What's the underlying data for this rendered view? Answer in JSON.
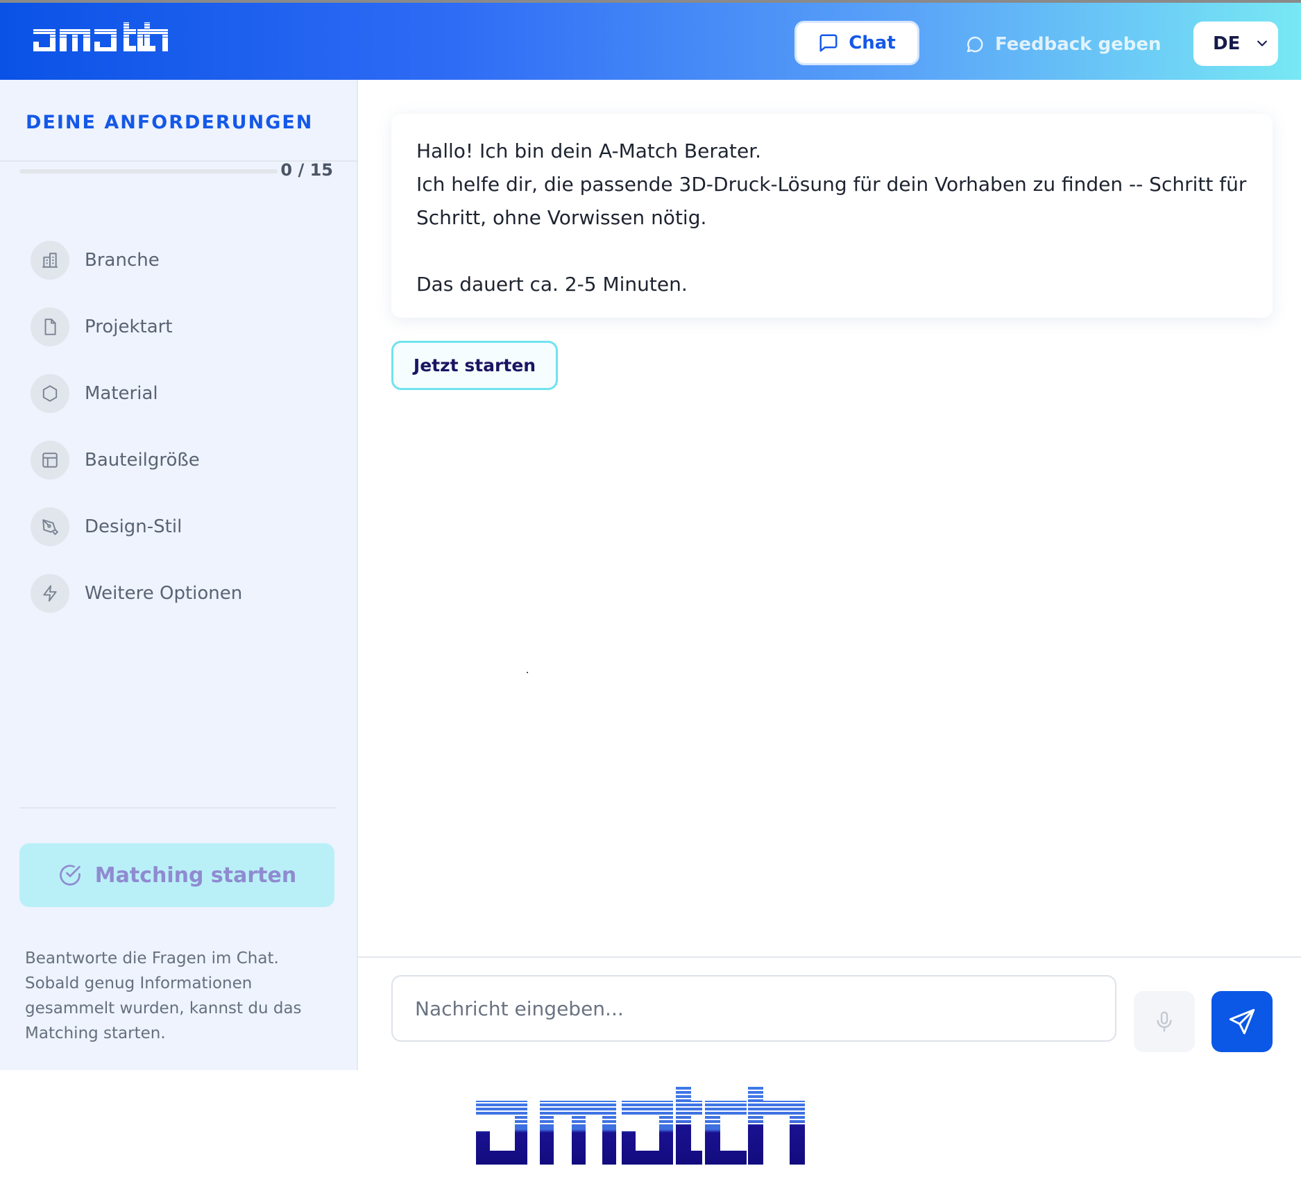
{
  "header": {
    "logo_text": "amatch",
    "nav": {
      "chat_label": "Chat",
      "feedback_label": "Feedback geben"
    },
    "language": {
      "selected": "DE"
    },
    "colors": {
      "primary": "#1558e8",
      "gradient_start": "#0a52e6",
      "gradient_end": "#78e8f4"
    }
  },
  "sidebar": {
    "title": "DEINE ANFORDERUNGEN",
    "progress": {
      "label": "0 / 15",
      "done": 0,
      "total": 15
    },
    "items": [
      {
        "label": "Branche",
        "icon": "building-icon"
      },
      {
        "label": "Projektart",
        "icon": "document-icon"
      },
      {
        "label": "Material",
        "icon": "hexagon-icon"
      },
      {
        "label": "Bauteilgröße",
        "icon": "layout-grid-icon"
      },
      {
        "label": "Design-Stil",
        "icon": "pen-tool-icon"
      },
      {
        "label": "Weitere Optionen",
        "icon": "lightning-icon"
      }
    ],
    "matching_button": "Matching starten",
    "hint": "Beantworte die Fragen im Chat. Sobald genug Informationen gesammelt wurden, kannst du das Matching starten."
  },
  "chat": {
    "message": {
      "line1": "Hallo! Ich bin dein A-Match Berater.",
      "line2": "Ich helfe dir, die passende 3D-Druck-Lösung für dein Vorhaben zu finden -- Schritt für Schritt, ohne Vorwissen nötig.",
      "line3": "Das dauert ca. 2-5 Minuten."
    },
    "start_button": "Jetzt starten",
    "input": {
      "placeholder": "Nachricht eingeben...",
      "value": ""
    }
  },
  "footer": {
    "logo_text": "amatch"
  }
}
